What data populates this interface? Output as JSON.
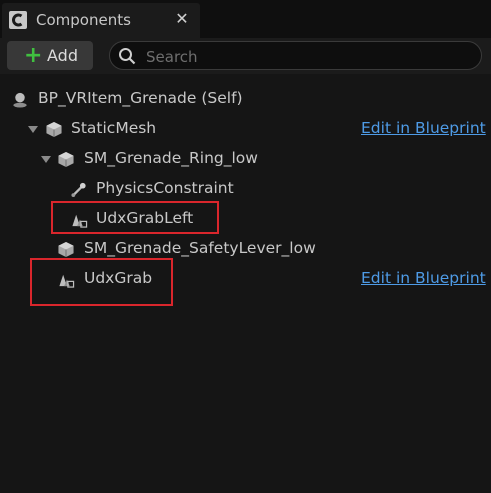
{
  "tab": {
    "title": "Components",
    "close_glyph": "✕"
  },
  "toolbar": {
    "add_label": "Add",
    "search_placeholder": "Search"
  },
  "tree": {
    "root": {
      "label": "BP_VRItem_Grenade (Self)"
    },
    "static_mesh": {
      "label": "StaticMesh",
      "link": "Edit in Blueprint"
    },
    "ring": {
      "label": "SM_Grenade_Ring_low"
    },
    "physics": {
      "label": "PhysicsConstraint"
    },
    "grab_left": {
      "label": "UdxGrabLeft"
    },
    "safety_lever": {
      "label": "SM_Grenade_SafetyLever_low"
    },
    "grab": {
      "label": "UdxGrab",
      "link": "Edit in Blueprint"
    }
  },
  "colors": {
    "highlight": "#d9262c",
    "link": "#4e9be6",
    "add_plus": "#40c040"
  }
}
